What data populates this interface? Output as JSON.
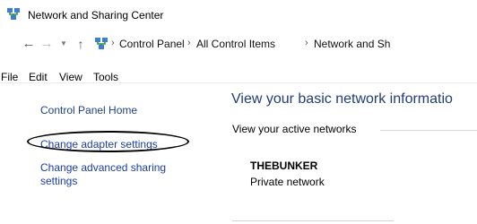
{
  "window": {
    "title": "Network and Sharing Center",
    "icon": "network-sharing-icon"
  },
  "address_bar": {
    "back_icon": "arrow-left-icon",
    "forward_icon": "arrow-right-icon",
    "recent_icon": "chevron-down-icon",
    "up_icon": "arrow-up-icon",
    "location_icon": "control-panel-icon",
    "breadcrumbs": [
      "Control Panel",
      "All Control Items",
      "Network and Sh"
    ]
  },
  "menu": [
    "File",
    "Edit",
    "View",
    "Tools"
  ],
  "sidebar": {
    "home": "Control Panel Home",
    "adapter": "Change adapter settings",
    "advanced": "Change advanced sharing settings"
  },
  "main": {
    "heading": "View your basic network informatio",
    "active_label": "View your active networks",
    "network_name": "THEBUNKER",
    "network_type": "Private network"
  },
  "colors": {
    "link": "#1a3dab",
    "heading": "#1f3d7a"
  }
}
